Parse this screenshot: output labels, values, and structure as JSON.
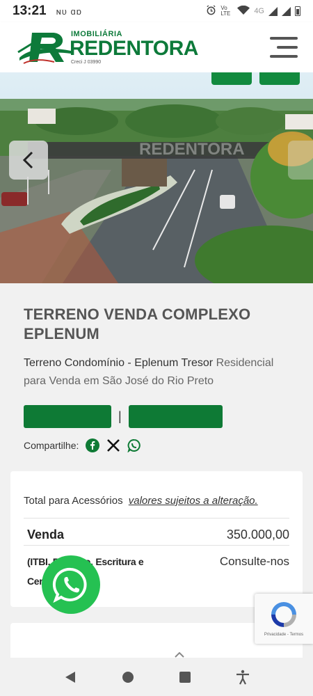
{
  "status_bar": {
    "time": "13:21",
    "left_icons": "ɴᴜ ɑɒ",
    "network": "Vo LTE",
    "signal_4g": "4G"
  },
  "header": {
    "logo_small": "IMOBILIÁRIA",
    "logo_big": "REDENTORA",
    "logo_creci": "Creci J 03990",
    "menu_icon": "hamburger-icon"
  },
  "hero": {
    "watermark": "REDENTORA",
    "prev_icon": "chevron-left-icon"
  },
  "listing": {
    "title": "TERRENO VENDA COMPLEXO EPLENUM",
    "subtitle_main": "Terreno Condomínio - Eplenum Tresor",
    "subtitle_rest": " Residencial para Venda em São José do Rio Preto",
    "separator": "|",
    "share_label": "Compartilhe:"
  },
  "price_card": {
    "note": "Total para Acessórios",
    "note_link": "valores sujeitos a alteração.",
    "sale_label": "Venda",
    "sale_value": "350.000,00",
    "fees_label_line1": "(ITBI, Registro, Escritura e",
    "fees_label_line2": "Certidões)",
    "fees_value": "Consulte-nos"
  },
  "recaptcha": {
    "links": "Privacidade - Termos"
  },
  "colors": {
    "brand_green": "#0d7a3a",
    "button_green": "#0e7a35",
    "whatsapp_green": "#25c152"
  }
}
